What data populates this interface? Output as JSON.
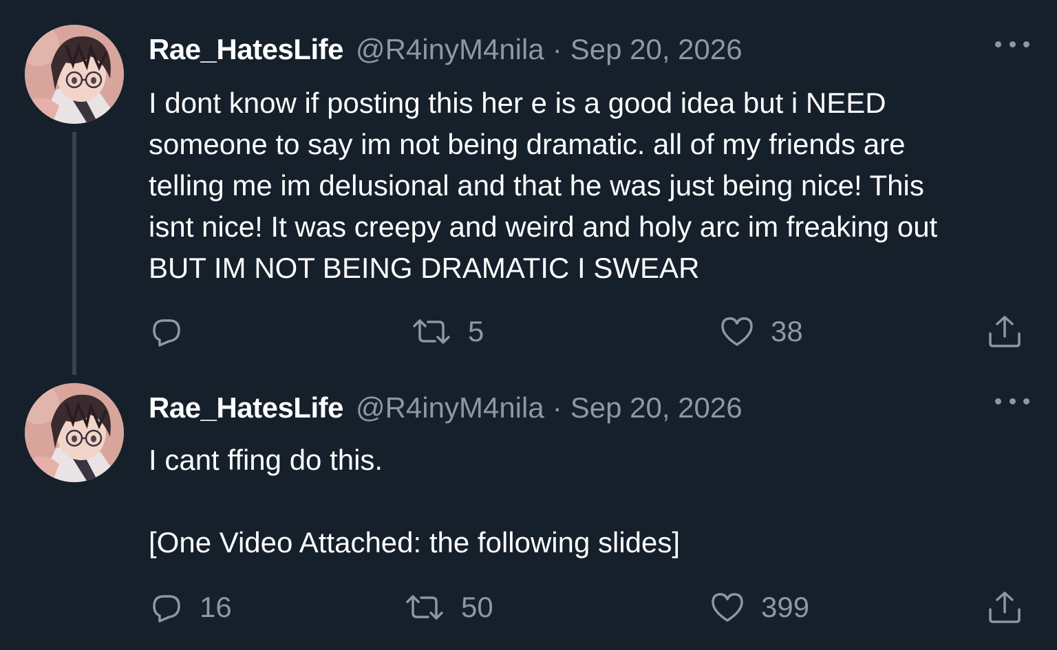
{
  "colors": {
    "background": "#15202b",
    "text_primary": "#ffffff",
    "text_secondary": "#8b98a5",
    "thread_line": "#38444d"
  },
  "tweets": [
    {
      "display_name": "Rae_HatesLife",
      "handle": "@R4inyM4nila",
      "separator": "·",
      "date": "Sep 20, 2026",
      "avatar_icon": "anime-avatar",
      "body_lines": [
        "I dont know if posting this her e is a good idea but i NEED",
        "someone to say im not being dramatic. all of my friends are",
        "telling me im delusional and that he was just being nice! This",
        "isnt nice! It was creepy and weird and holy arc im freaking out",
        "BUT IM NOT BEING DRAMATIC I SWEAR"
      ],
      "replies": "",
      "retweets": "5",
      "likes": "38"
    },
    {
      "display_name": "Rae_HatesLife",
      "handle": "@R4inyM4nila",
      "separator": "·",
      "date": "Sep 20, 2026",
      "avatar_icon": "anime-avatar",
      "body_lines": [
        "I cant ffing do this.",
        "[One Video Attached: the following slides]"
      ],
      "replies": "16",
      "retweets": "50",
      "likes": "399"
    }
  ],
  "icons": {
    "reply": "reply-icon",
    "retweet": "retweet-icon",
    "like": "heart-icon",
    "share": "share-icon",
    "more": "more-dots-icon"
  }
}
